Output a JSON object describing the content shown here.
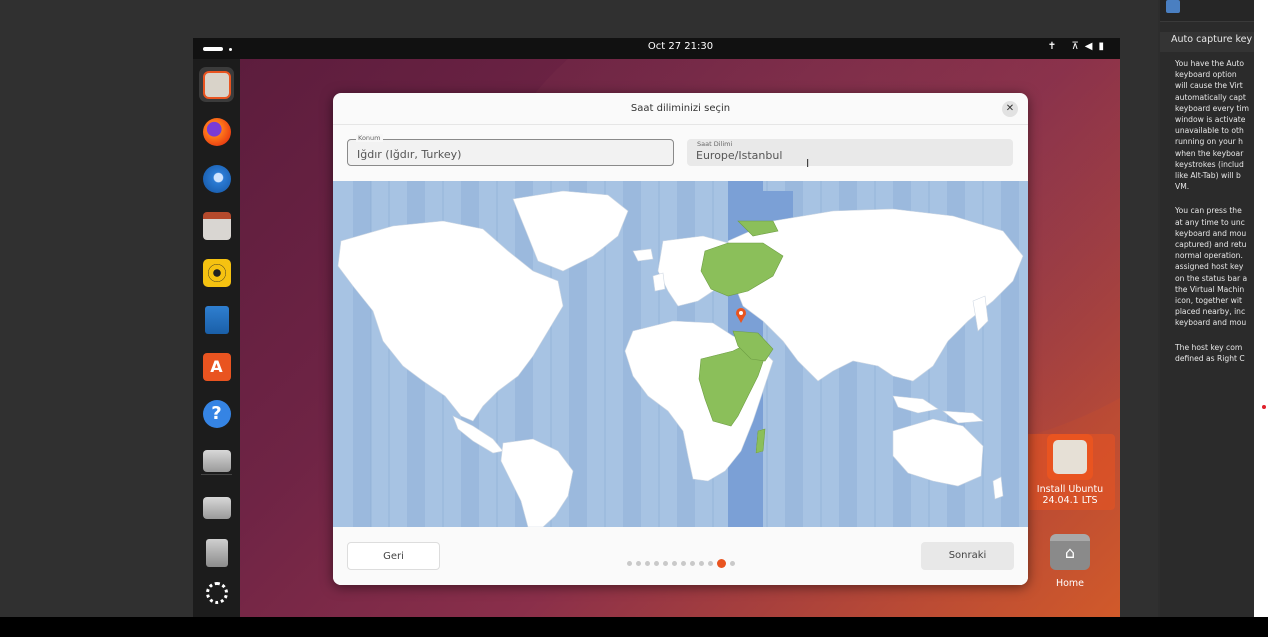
{
  "topbar": {
    "clock": "Oct 27  21:30"
  },
  "dialog": {
    "title": "Saat diliminizi seçin",
    "close_glyph": "✕",
    "location_label": "Konum",
    "location_value": "Iğdır (Iğdır, Turkey)",
    "timezone_label": "Saat Dilimi",
    "timezone_value": "Europe/Istanbul",
    "back_label": "Geri",
    "next_label": "Sonraki",
    "pages_total": 12,
    "current_page": 11
  },
  "desktop": {
    "install_label_1": "Install Ubuntu",
    "install_label_2": "24.04.1 LTS",
    "home_label": "Home"
  },
  "help_panel": {
    "title": "Auto capture key",
    "p1": [
      "You have the Auto",
      "keyboard option",
      "will cause the Virt",
      "automatically capt",
      "keyboard every tim",
      "window is activate",
      "unavailable to oth",
      "running on your h",
      "when the keyboar",
      "keystrokes (includ",
      "like Alt-Tab) will b",
      "VM."
    ],
    "p2": [
      "You can press the",
      "at any time to unc",
      "keyboard and mou",
      "captured) and retu",
      "normal operation.",
      "assigned host key",
      "on the status bar a",
      "the Virtual Machin",
      "icon, together wit",
      "placed nearby, inc",
      "keyboard and mou"
    ],
    "p3": [
      "The host key com",
      "defined as Right C"
    ]
  },
  "dock_items": [
    "ubuntu-installer-icon",
    "firefox-icon",
    "thunderbird-icon",
    "files-icon",
    "rhythmbox-icon",
    "writer-icon",
    "app-center-icon",
    "help-icon",
    "drive-icon",
    "drive-icon",
    "trash-icon",
    "show-apps-icon"
  ],
  "colors": {
    "accent": "#e95420",
    "selected_zone": "#7ba0d6",
    "selected_country": "#8bbf5a",
    "ocean": "#a7c3e3"
  }
}
